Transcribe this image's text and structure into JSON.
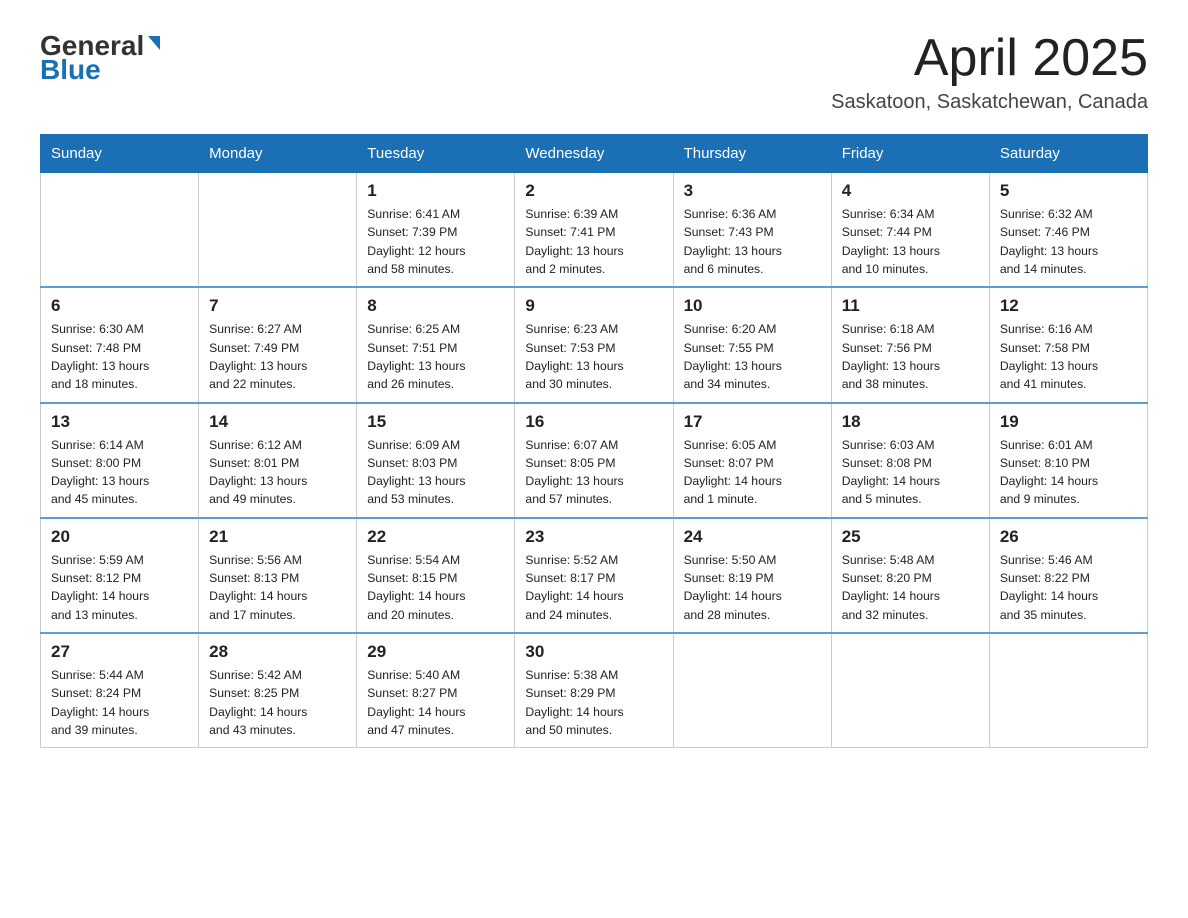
{
  "header": {
    "logo_general": "General",
    "logo_blue": "Blue",
    "month_title": "April 2025",
    "location": "Saskatoon, Saskatchewan, Canada"
  },
  "weekdays": [
    "Sunday",
    "Monday",
    "Tuesday",
    "Wednesday",
    "Thursday",
    "Friday",
    "Saturday"
  ],
  "weeks": [
    [
      {
        "day": "",
        "info": ""
      },
      {
        "day": "",
        "info": ""
      },
      {
        "day": "1",
        "info": "Sunrise: 6:41 AM\nSunset: 7:39 PM\nDaylight: 12 hours\nand 58 minutes."
      },
      {
        "day": "2",
        "info": "Sunrise: 6:39 AM\nSunset: 7:41 PM\nDaylight: 13 hours\nand 2 minutes."
      },
      {
        "day": "3",
        "info": "Sunrise: 6:36 AM\nSunset: 7:43 PM\nDaylight: 13 hours\nand 6 minutes."
      },
      {
        "day": "4",
        "info": "Sunrise: 6:34 AM\nSunset: 7:44 PM\nDaylight: 13 hours\nand 10 minutes."
      },
      {
        "day": "5",
        "info": "Sunrise: 6:32 AM\nSunset: 7:46 PM\nDaylight: 13 hours\nand 14 minutes."
      }
    ],
    [
      {
        "day": "6",
        "info": "Sunrise: 6:30 AM\nSunset: 7:48 PM\nDaylight: 13 hours\nand 18 minutes."
      },
      {
        "day": "7",
        "info": "Sunrise: 6:27 AM\nSunset: 7:49 PM\nDaylight: 13 hours\nand 22 minutes."
      },
      {
        "day": "8",
        "info": "Sunrise: 6:25 AM\nSunset: 7:51 PM\nDaylight: 13 hours\nand 26 minutes."
      },
      {
        "day": "9",
        "info": "Sunrise: 6:23 AM\nSunset: 7:53 PM\nDaylight: 13 hours\nand 30 minutes."
      },
      {
        "day": "10",
        "info": "Sunrise: 6:20 AM\nSunset: 7:55 PM\nDaylight: 13 hours\nand 34 minutes."
      },
      {
        "day": "11",
        "info": "Sunrise: 6:18 AM\nSunset: 7:56 PM\nDaylight: 13 hours\nand 38 minutes."
      },
      {
        "day": "12",
        "info": "Sunrise: 6:16 AM\nSunset: 7:58 PM\nDaylight: 13 hours\nand 41 minutes."
      }
    ],
    [
      {
        "day": "13",
        "info": "Sunrise: 6:14 AM\nSunset: 8:00 PM\nDaylight: 13 hours\nand 45 minutes."
      },
      {
        "day": "14",
        "info": "Sunrise: 6:12 AM\nSunset: 8:01 PM\nDaylight: 13 hours\nand 49 minutes."
      },
      {
        "day": "15",
        "info": "Sunrise: 6:09 AM\nSunset: 8:03 PM\nDaylight: 13 hours\nand 53 minutes."
      },
      {
        "day": "16",
        "info": "Sunrise: 6:07 AM\nSunset: 8:05 PM\nDaylight: 13 hours\nand 57 minutes."
      },
      {
        "day": "17",
        "info": "Sunrise: 6:05 AM\nSunset: 8:07 PM\nDaylight: 14 hours\nand 1 minute."
      },
      {
        "day": "18",
        "info": "Sunrise: 6:03 AM\nSunset: 8:08 PM\nDaylight: 14 hours\nand 5 minutes."
      },
      {
        "day": "19",
        "info": "Sunrise: 6:01 AM\nSunset: 8:10 PM\nDaylight: 14 hours\nand 9 minutes."
      }
    ],
    [
      {
        "day": "20",
        "info": "Sunrise: 5:59 AM\nSunset: 8:12 PM\nDaylight: 14 hours\nand 13 minutes."
      },
      {
        "day": "21",
        "info": "Sunrise: 5:56 AM\nSunset: 8:13 PM\nDaylight: 14 hours\nand 17 minutes."
      },
      {
        "day": "22",
        "info": "Sunrise: 5:54 AM\nSunset: 8:15 PM\nDaylight: 14 hours\nand 20 minutes."
      },
      {
        "day": "23",
        "info": "Sunrise: 5:52 AM\nSunset: 8:17 PM\nDaylight: 14 hours\nand 24 minutes."
      },
      {
        "day": "24",
        "info": "Sunrise: 5:50 AM\nSunset: 8:19 PM\nDaylight: 14 hours\nand 28 minutes."
      },
      {
        "day": "25",
        "info": "Sunrise: 5:48 AM\nSunset: 8:20 PM\nDaylight: 14 hours\nand 32 minutes."
      },
      {
        "day": "26",
        "info": "Sunrise: 5:46 AM\nSunset: 8:22 PM\nDaylight: 14 hours\nand 35 minutes."
      }
    ],
    [
      {
        "day": "27",
        "info": "Sunrise: 5:44 AM\nSunset: 8:24 PM\nDaylight: 14 hours\nand 39 minutes."
      },
      {
        "day": "28",
        "info": "Sunrise: 5:42 AM\nSunset: 8:25 PM\nDaylight: 14 hours\nand 43 minutes."
      },
      {
        "day": "29",
        "info": "Sunrise: 5:40 AM\nSunset: 8:27 PM\nDaylight: 14 hours\nand 47 minutes."
      },
      {
        "day": "30",
        "info": "Sunrise: 5:38 AM\nSunset: 8:29 PM\nDaylight: 14 hours\nand 50 minutes."
      },
      {
        "day": "",
        "info": ""
      },
      {
        "day": "",
        "info": ""
      },
      {
        "day": "",
        "info": ""
      }
    ]
  ]
}
